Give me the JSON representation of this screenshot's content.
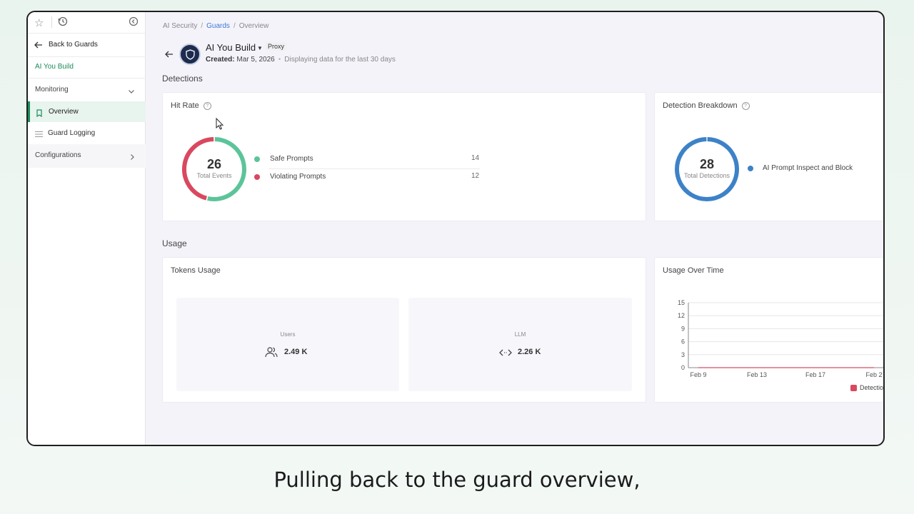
{
  "sidebar": {
    "back_label": "Back to Guards",
    "guard_name": "AI You Build",
    "monitoring_label": "Monitoring",
    "items": [
      {
        "label": "Overview",
        "active": true
      },
      {
        "label": "Guard Logging",
        "active": false
      }
    ],
    "configurations_label": "Configurations"
  },
  "breadcrumb": {
    "root": "AI Security",
    "guards": "Guards",
    "current": "Overview"
  },
  "header": {
    "name": "AI You Build",
    "type_badge": "Proxy",
    "created_label": "Created:",
    "created_date": "Mar 5, 2026",
    "range_note": "Displaying data for the last 30 days"
  },
  "detections": {
    "section_title": "Detections",
    "hit_rate": {
      "title": "Hit Rate",
      "total": "26",
      "total_label": "Total Events",
      "legend": [
        {
          "label": "Safe Prompts",
          "value": "14",
          "color": "#5cc49a"
        },
        {
          "label": "Violating Prompts",
          "value": "12",
          "color": "#d9485f"
        }
      ]
    },
    "breakdown": {
      "title": "Detection Breakdown",
      "total": "28",
      "total_label": "Total Detections",
      "legend": [
        {
          "label": "AI Prompt Inspect and Block",
          "color": "#3d82c8"
        }
      ]
    }
  },
  "usage": {
    "section_title": "Usage",
    "tokens": {
      "title": "Tokens Usage",
      "users_label": "Users",
      "users_value": "2.49 K",
      "llm_label": "LLM",
      "llm_value": "2.26 K"
    },
    "over_time": {
      "title": "Usage Over Time",
      "legend_label": "Detectio"
    }
  },
  "chart_data": {
    "type": "line",
    "title": "Usage Over Time",
    "x": [
      "Feb 9",
      "Feb 13",
      "Feb 17",
      "Feb 2"
    ],
    "y_ticks": [
      0,
      3,
      6,
      9,
      12,
      15
    ],
    "ylim": [
      0,
      15
    ],
    "series": [
      {
        "name": "Detectio",
        "values": [
          0,
          0,
          0,
          0
        ]
      }
    ],
    "grid": true,
    "legend": "bottom-right"
  },
  "caption": "Pulling back to the guard overview,"
}
